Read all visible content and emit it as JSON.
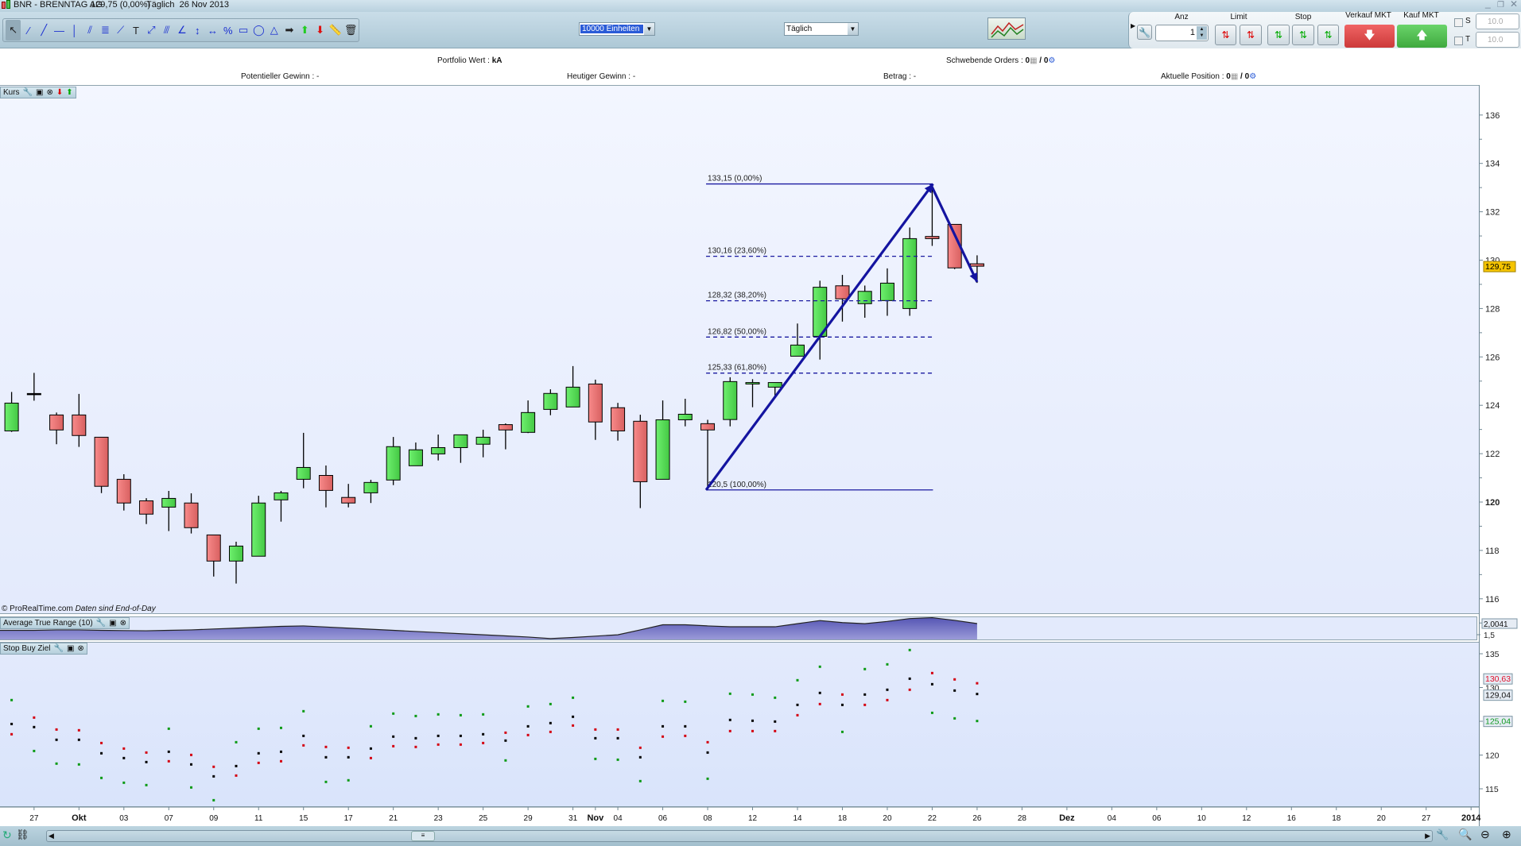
{
  "window": {
    "symbol": "BNR - BRENNTAG AG",
    "price": "129,75 (0,00%)",
    "period_date": "Täglich  26 Nov 2013",
    "controls": [
      "minimize-icon",
      "restore-icon",
      "close-icon"
    ]
  },
  "toolbar": {
    "tools": [
      {
        "name": "cursor-icon",
        "glyph": "↖"
      },
      {
        "name": "segment-icon",
        "glyph": "⁄"
      },
      {
        "name": "line-icon",
        "glyph": "╱"
      },
      {
        "name": "horizontal-line-icon",
        "glyph": "—"
      },
      {
        "name": "vertical-line-icon",
        "glyph": "│"
      },
      {
        "name": "channel-icon",
        "glyph": "⫽"
      },
      {
        "name": "fibonacci-icon",
        "glyph": "≣"
      },
      {
        "name": "regression-icon",
        "glyph": "⟋"
      },
      {
        "name": "text-icon",
        "glyph": "T"
      },
      {
        "name": "fan-icon",
        "glyph": "⤢"
      },
      {
        "name": "parallel-icon",
        "glyph": "⫻"
      },
      {
        "name": "angle-icon",
        "glyph": "∠"
      },
      {
        "name": "vertical-measure-icon",
        "glyph": "↕"
      },
      {
        "name": "horizontal-measure-icon",
        "glyph": "↔"
      },
      {
        "name": "percent-icon",
        "glyph": "%"
      },
      {
        "name": "rectangle-icon",
        "glyph": "▭"
      },
      {
        "name": "ellipse-icon",
        "glyph": "◯"
      },
      {
        "name": "triangle-icon",
        "glyph": "△"
      },
      {
        "name": "arrow-right-icon",
        "glyph": "➡"
      },
      {
        "name": "arrow-up-icon",
        "glyph": "⬆"
      },
      {
        "name": "arrow-down-icon",
        "glyph": "⬇"
      },
      {
        "name": "ruler-icon",
        "glyph": "📏"
      },
      {
        "name": "trash-icon",
        "glyph": "🗑"
      }
    ],
    "units_dropdown": "10000 Einheiten",
    "period_dropdown": "Täglich"
  },
  "order_panel": {
    "qty_label": "Anz",
    "qty_value": "1",
    "limit_label": "Limit",
    "stop_label": "Stop",
    "sell_label": "Verkauf MKT",
    "buy_label": "Kauf MKT",
    "s_label": "S",
    "t_label": "T",
    "s_value": "10.0",
    "t_value": "10.0",
    "sell_color": "#e04848",
    "buy_color": "#4cbe4c"
  },
  "info": {
    "portfolio_label": "Portfolio Wert : ",
    "portfolio_value": "kA",
    "pending_label": "Schwebende Orders : ",
    "pending_value_a": "0",
    "pending_sep": " / ",
    "pending_value_b": "0",
    "potential_gain": "Potentieller Gewinn : -",
    "today_gain": "Heutiger Gewinn : -",
    "amount": "Betrag : -",
    "position_label": "Aktuelle Position : ",
    "position_value_a": "0",
    "position_sep": " / ",
    "position_value_b": "0"
  },
  "panels": {
    "price": "Kurs",
    "atr": "Average True Range (10)",
    "stop": "Stop Buy Ziel",
    "copyright": "© ProRealTime.com",
    "copyright_note": "Daten sind End-of-Day"
  },
  "chart_data": {
    "type": "candlestick",
    "colors": {
      "up": "#55d455",
      "down": "#ee7777",
      "fib": "#1a1aa0",
      "price_tag": "#f5c400"
    },
    "candles": [
      [
        "26.09",
        122.94,
        124.55,
        122.9,
        124.09
      ],
      [
        "27.09",
        124.47,
        125.34,
        124.19,
        124.47
      ],
      [
        "30.09",
        123.6,
        123.7,
        122.39,
        122.98
      ],
      [
        "01.10",
        123.6,
        124.47,
        122.28,
        122.75
      ],
      [
        "02.10",
        122.68,
        122.68,
        120.37,
        120.65
      ],
      [
        "03.10",
        120.94,
        121.15,
        119.65,
        119.96
      ],
      [
        "04.10",
        120.05,
        120.16,
        119.09,
        119.5
      ],
      [
        "07.10",
        119.79,
        120.46,
        118.8,
        120.15
      ],
      [
        "08.10",
        119.96,
        120.36,
        118.7,
        118.94
      ],
      [
        "09.10",
        118.64,
        118.64,
        116.92,
        117.56
      ],
      [
        "10.10",
        117.56,
        118.36,
        116.63,
        118.18
      ],
      [
        "11.10",
        117.76,
        120.26,
        117.76,
        119.96
      ],
      [
        "14.10",
        120.09,
        120.46,
        119.19,
        120.38
      ],
      [
        "15.10",
        120.94,
        122.86,
        120.57,
        121.43
      ],
      [
        "16.10",
        121.1,
        121.51,
        119.78,
        120.48
      ],
      [
        "17.10",
        120.19,
        120.75,
        119.78,
        119.96
      ],
      [
        "18.10",
        120.38,
        120.92,
        119.96,
        120.81
      ],
      [
        "21.10",
        120.91,
        122.69,
        120.7,
        122.29
      ],
      [
        "22.10",
        121.5,
        122.46,
        121.5,
        122.16
      ],
      [
        "23.10",
        121.99,
        122.79,
        121.72,
        122.25
      ],
      [
        "24.10",
        122.25,
        122.78,
        121.62,
        122.78
      ],
      [
        "25.10",
        122.39,
        122.99,
        121.85,
        122.68
      ],
      [
        "28.10",
        123.2,
        123.25,
        122.18,
        122.98
      ],
      [
        "29.10",
        122.88,
        124.2,
        122.85,
        123.7
      ],
      [
        "30.10",
        123.83,
        124.66,
        123.59,
        124.49
      ],
      [
        "31.10",
        123.93,
        125.62,
        123.93,
        124.75
      ],
      [
        "01.11",
        124.88,
        125.06,
        122.57,
        123.31
      ],
      [
        "04.11",
        123.9,
        124.1,
        122.54,
        122.94
      ],
      [
        "05.11",
        123.34,
        123.61,
        119.75,
        120.84
      ],
      [
        "06.11",
        120.94,
        124.2,
        120.94,
        123.4
      ],
      [
        "07.11",
        123.4,
        124.27,
        123.13,
        123.63
      ],
      [
        "08.11",
        123.24,
        123.4,
        120.5,
        122.98
      ],
      [
        "11.11",
        123.41,
        125.16,
        123.13,
        124.98
      ],
      [
        "12.11",
        124.88,
        125.08,
        123.92,
        124.94
      ],
      [
        "13.11",
        124.75,
        124.94,
        124.34,
        124.94
      ],
      [
        "14.11",
        126.03,
        127.38,
        126.03,
        126.49
      ],
      [
        "15.11",
        126.85,
        129.15,
        125.89,
        128.88
      ],
      [
        "18.11",
        128.94,
        129.39,
        127.46,
        128.4
      ],
      [
        "19.11",
        128.2,
        128.95,
        127.62,
        128.71
      ],
      [
        "20.11",
        128.33,
        129.66,
        127.7,
        129.05
      ],
      [
        "21.11",
        128.0,
        131.35,
        127.7,
        130.89
      ],
      [
        "22.11",
        130.98,
        133.15,
        130.59,
        130.89
      ],
      [
        "25.11",
        131.48,
        131.48,
        129.63,
        129.68
      ],
      [
        "26.11",
        129.85,
        130.2,
        129.06,
        129.75
      ]
    ],
    "price_axis": {
      "ticks": [
        "116",
        "118",
        "120",
        "122",
        "124",
        "126",
        "128",
        "130",
        "132",
        "134",
        "136"
      ],
      "tick_values": [
        116,
        118,
        120,
        122,
        124,
        126,
        128,
        130,
        132,
        134,
        136
      ],
      "bold_tick": "120",
      "current": "129,75",
      "current_value": 129.75
    },
    "fibonacci": {
      "from_index": 31,
      "to_index": 41,
      "levels": [
        {
          "label": "133,15 (0,00%)",
          "value": 133.15,
          "solid": true
        },
        {
          "label": "130,16 (23,60%)",
          "value": 130.16,
          "solid": false
        },
        {
          "label": "128,32 (38,20%)",
          "value": 128.32,
          "solid": false
        },
        {
          "label": "126,82 (50,00%)",
          "value": 126.82,
          "solid": false
        },
        {
          "label": "125,33 (61,80%)",
          "value": 125.33,
          "solid": false
        },
        {
          "label": "120,5 (100,00%)",
          "value": 120.5,
          "solid": true
        }
      ]
    },
    "trend_arrows": [
      [
        31,
        120.5
      ],
      [
        41,
        133.15
      ],
      [
        43,
        129.1
      ]
    ],
    "atr": {
      "values": [
        1.7,
        1.7,
        1.72,
        1.72,
        1.7,
        1.69,
        1.68,
        1.7,
        1.72,
        1.76,
        1.8,
        1.84,
        1.88,
        1.9,
        1.85,
        1.8,
        1.75,
        1.7,
        1.65,
        1.6,
        1.55,
        1.5,
        1.45,
        1.4,
        1.33,
        1.38,
        1.44,
        1.5,
        1.72,
        1.95,
        1.95,
        1.9,
        1.86,
        1.86,
        1.86,
        2.0,
        2.14,
        2.05,
        2.0,
        2.1,
        2.23,
        2.27,
        2.15,
        2.0041
      ],
      "current": "2,0041",
      "current_value": 2.0041,
      "tick": "1,5",
      "tick_value": 1.5
    },
    "stop_buy": {
      "green": [
        128.14,
        120.6,
        118.73,
        118.61,
        116.61,
        115.9,
        115.55,
        123.9,
        115.2,
        113.31,
        121.9,
        123.9,
        124.02,
        126.49,
        116.02,
        116.26,
        124.26,
        126.14,
        125.78,
        126.02,
        125.9,
        126.02,
        119.2,
        127.2,
        127.55,
        128.49,
        119.43,
        119.31,
        116.14,
        128.02,
        127.9,
        116.49,
        129.08,
        128.96,
        128.49,
        131.08,
        133.08,
        123.43,
        132.73,
        133.43,
        135.55,
        126.25,
        125.43,
        125.04
      ],
      "black": [
        124.6,
        124.14,
        122.26,
        122.26,
        120.26,
        119.55,
        118.96,
        120.49,
        118.61,
        116.84,
        118.37,
        120.26,
        120.49,
        122.84,
        119.67,
        119.67,
        120.96,
        122.73,
        122.49,
        122.84,
        122.84,
        123.08,
        122.14,
        124.25,
        124.73,
        125.67,
        122.49,
        122.49,
        119.67,
        124.25,
        124.25,
        120.37,
        125.2,
        125.08,
        124.96,
        127.43,
        129.2,
        127.43,
        128.96,
        129.67,
        131.31,
        130.49,
        129.55,
        129.04
      ],
      "red": [
        123.08,
        125.55,
        123.78,
        123.67,
        121.78,
        120.96,
        120.37,
        119.08,
        120.02,
        118.26,
        116.96,
        118.84,
        119.08,
        121.43,
        121.2,
        121.08,
        119.55,
        121.31,
        121.2,
        121.55,
        121.55,
        121.78,
        123.31,
        122.96,
        123.43,
        124.37,
        123.78,
        123.78,
        121.08,
        122.73,
        122.84,
        121.9,
        123.55,
        123.55,
        123.55,
        125.9,
        127.55,
        128.96,
        127.43,
        128.14,
        129.67,
        132.14,
        131.2,
        130.63
      ],
      "ticks": [
        "115",
        "120",
        "125",
        "130",
        "135"
      ],
      "tick_values": [
        115,
        120,
        125,
        130,
        135
      ],
      "tags": [
        {
          "label": "130,63",
          "value": 130.63,
          "color": "#e0102a"
        },
        {
          "label": "129,04",
          "value": 129.04,
          "color": "#111111"
        },
        {
          "label": "125,04",
          "value": 125.04,
          "color": "#109a20"
        }
      ]
    },
    "date_labels": [
      {
        "label": "27",
        "index": 1
      },
      {
        "label": "Okt",
        "index": 3,
        "bold": true
      },
      {
        "label": "03",
        "index": 5
      },
      {
        "label": "07",
        "index": 7
      },
      {
        "label": "09",
        "index": 9
      },
      {
        "label": "11",
        "index": 11
      },
      {
        "label": "15",
        "index": 13
      },
      {
        "label": "17",
        "index": 15
      },
      {
        "label": "21",
        "index": 17
      },
      {
        "label": "23",
        "index": 19
      },
      {
        "label": "25",
        "index": 21
      },
      {
        "label": "29",
        "index": 23
      },
      {
        "label": "31",
        "index": 25
      },
      {
        "label": "Nov",
        "index": 26,
        "bold": true
      },
      {
        "label": "04",
        "index": 27
      },
      {
        "label": "06",
        "index": 29
      },
      {
        "label": "08",
        "index": 31
      },
      {
        "label": "12",
        "index": 33
      },
      {
        "label": "14",
        "index": 35
      },
      {
        "label": "18",
        "index": 37
      },
      {
        "label": "20",
        "index": 39
      },
      {
        "label": "22",
        "index": 41
      },
      {
        "label": "26",
        "index": 43
      },
      {
        "label": "28",
        "index": 45
      },
      {
        "label": "Dez",
        "index": 47,
        "bold": true
      },
      {
        "label": "04",
        "index": 49
      },
      {
        "label": "06",
        "index": 51
      },
      {
        "label": "10",
        "index": 53
      },
      {
        "label": "12",
        "index": 55
      },
      {
        "label": "16",
        "index": 57
      },
      {
        "label": "18",
        "index": 59
      },
      {
        "label": "20",
        "index": 61
      },
      {
        "label": "27",
        "index": 63
      },
      {
        "label": "2014",
        "index": 65,
        "bold": true
      }
    ]
  }
}
